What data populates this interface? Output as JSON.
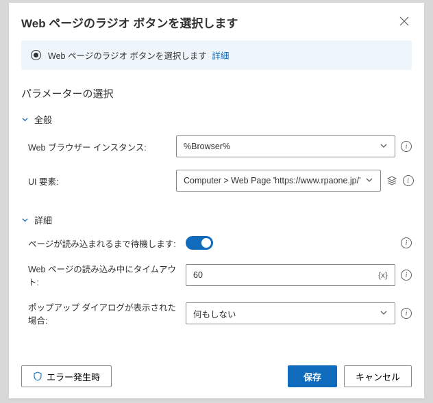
{
  "dialog": {
    "title": "Web ページのラジオ ボタンを選択します"
  },
  "banner": {
    "text": "Web ページのラジオ ボタンを選択します",
    "link": "詳細"
  },
  "sections": {
    "params_title": "パラメーターの選択",
    "general_label": "全般",
    "advanced_label": "詳細"
  },
  "fields": {
    "browser_instance": {
      "label": "Web ブラウザー インスタンス:",
      "value": "%Browser%"
    },
    "ui_element": {
      "label": "UI 要素:",
      "value": "Computer > Web Page 'https://www.rpaone.jp/'"
    },
    "wait_load": {
      "label": "ページが読み込まれるまで待機します:"
    },
    "timeout": {
      "label": "Web ページの読み込み中にタイムアウト:",
      "value": "60",
      "token": "{x}"
    },
    "popup": {
      "label": "ポップアップ ダイアログが表示された場合:",
      "value": "何もしない"
    }
  },
  "footer": {
    "on_error": "エラー発生時",
    "save": "保存",
    "cancel": "キャンセル"
  }
}
